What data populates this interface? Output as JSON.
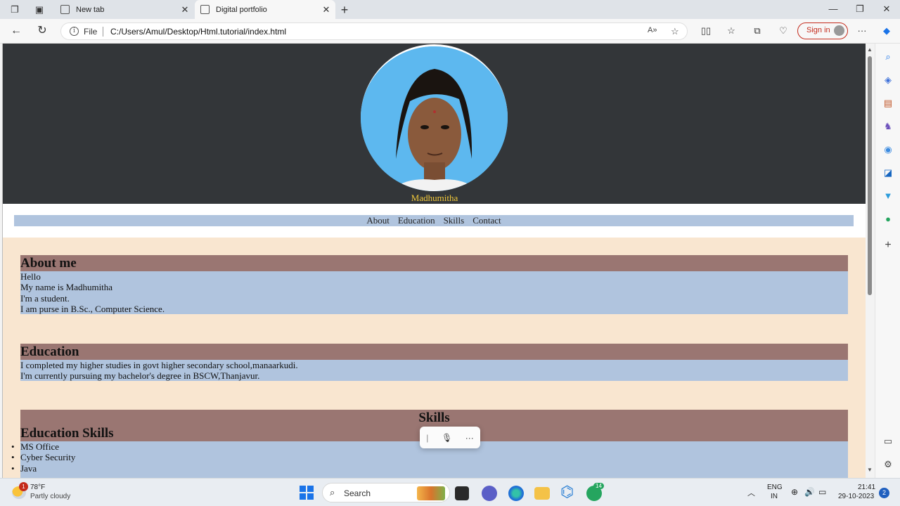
{
  "browser": {
    "tabs": [
      {
        "label": "New tab",
        "active": false
      },
      {
        "label": "Digital portfolio",
        "active": true
      }
    ],
    "address": {
      "scheme_label": "File",
      "url": "C:/Users/Amul/Desktop/Html.tutorial/index.html"
    },
    "sign_in_label": "Sign in"
  },
  "page": {
    "profile_name": "Madhumitha",
    "nav_links": [
      "About",
      "Education",
      "Skills",
      "Contact"
    ],
    "about": {
      "heading": "About me",
      "lines": [
        "Hello",
        "My name is Madhumitha",
        "I'm a student.",
        "I am purse in B.Sc., Computer Science."
      ]
    },
    "education": {
      "heading": "Education",
      "lines": [
        "I completed my higher studies in govt higher secondary school,manaarkudi.",
        "I'm currently pursuing my bachelor's degree in BSCW,Thanjavur."
      ]
    },
    "skills": {
      "heading": "Skills",
      "subheading": "Education Skills",
      "items": [
        "MS Office",
        "Cyber Security",
        "Java"
      ]
    }
  },
  "taskbar": {
    "weather": {
      "temp": "78°F",
      "condition": "Partly cloudy",
      "badge": "1"
    },
    "search_label": "Search",
    "whatsapp_badge": "14",
    "lang_top": "ENG",
    "lang_bottom": "IN",
    "time": "21:41",
    "date": "29-10-2023",
    "notification_count": "2"
  },
  "colors": {
    "hero_bg": "#333639",
    "name_color": "#f0c83a",
    "nav_bg": "#b0c4de",
    "content_bg": "#f9e6d0",
    "section_heading_bg": "#9a7672",
    "section_body_bg": "#b0c4de",
    "signin_accent": "#c42b1c"
  }
}
